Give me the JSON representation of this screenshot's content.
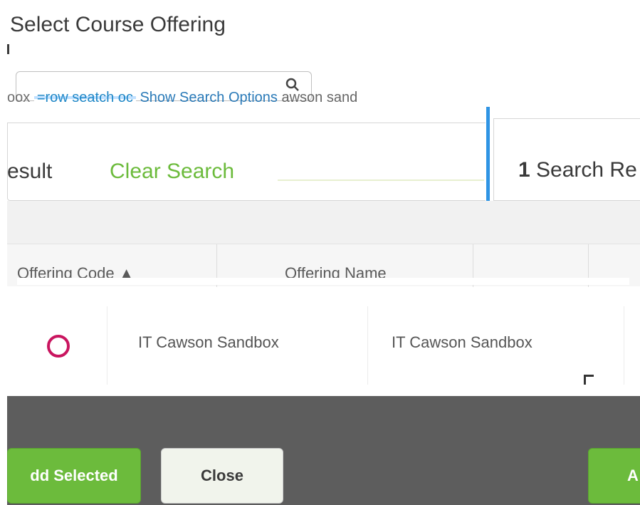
{
  "dialog": {
    "title": "Select Course Offering"
  },
  "search": {
    "placeholder_fragment": "oox",
    "overlay_text_1": "=row seatch oc",
    "overlay_text_2": "Show Search Options",
    "overlay_text_3": "awson sand"
  },
  "results": {
    "left_label": "esult",
    "clear_search": "Clear Search",
    "count": "1",
    "count_label": "Search Re"
  },
  "table": {
    "columns": [
      {
        "label": "Offering Code",
        "sort": "asc"
      },
      {
        "label": "Offering Name"
      }
    ],
    "rows": [
      {
        "code": "IT Cawson Sandbox",
        "name": "IT Cawson Sandbox"
      }
    ]
  },
  "footer": {
    "add_selected": "dd Selected",
    "close": "Close",
    "add_right": "A"
  },
  "colors": {
    "accent_green": "#6cbb3c",
    "radio_magenta": "#c9155f",
    "link_blue": "#1f87c7",
    "footer_grey": "#5d5d5d"
  }
}
